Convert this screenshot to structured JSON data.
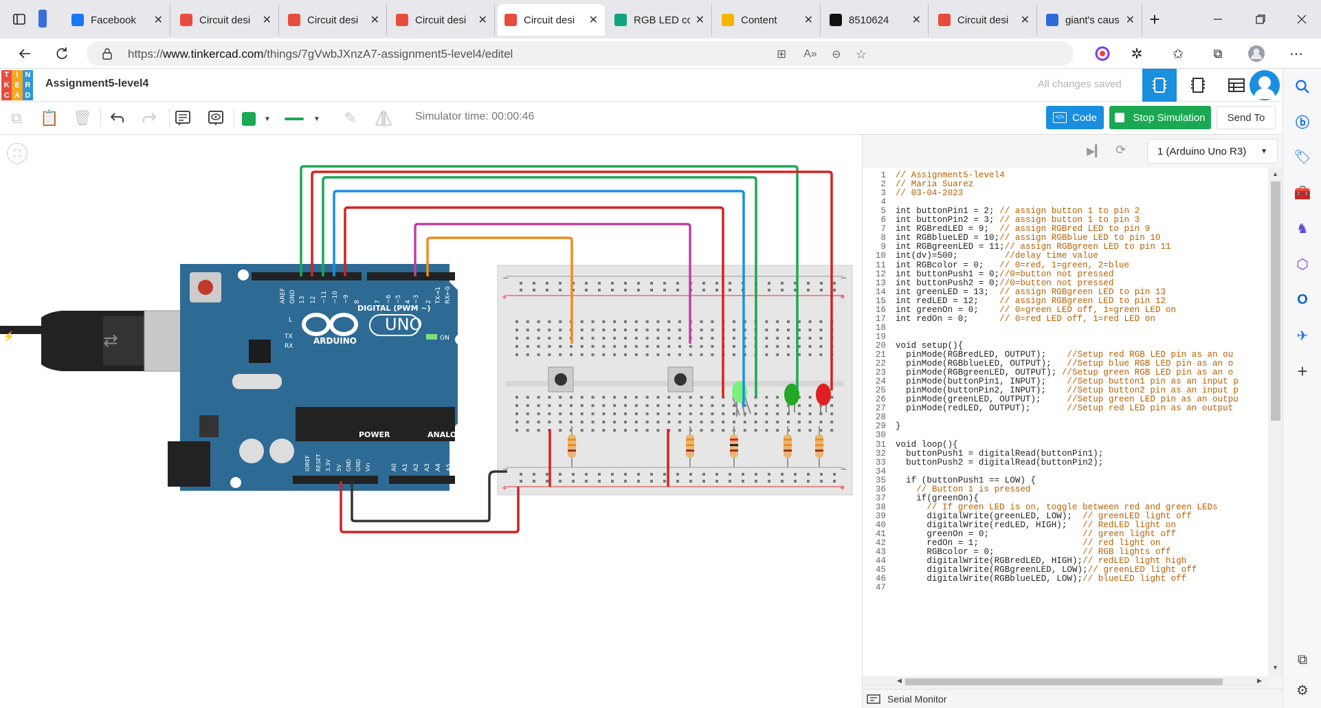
{
  "browser": {
    "tabs": [
      {
        "title": "Facebook",
        "icon": "facebook-icon",
        "color": "#1877f2",
        "active": false
      },
      {
        "title": "Circuit desi",
        "icon": "tinkercad-icon",
        "color": "#e84c3d",
        "active": false
      },
      {
        "title": "Circuit desi",
        "icon": "tinkercad-icon",
        "color": "#e84c3d",
        "active": false
      },
      {
        "title": "Circuit desi",
        "icon": "tinkercad-icon",
        "color": "#e84c3d",
        "active": false
      },
      {
        "title": "Circuit desi",
        "icon": "tinkercad-icon",
        "color": "#e84c3d",
        "active": true
      },
      {
        "title": "RGB LED co",
        "icon": "chatgpt-icon",
        "color": "#10a37f",
        "active": false
      },
      {
        "title": "Content",
        "icon": "pencil-icon",
        "color": "#f5b400",
        "active": false
      },
      {
        "title": "8510624",
        "icon": "blackboard-icon",
        "color": "#111111",
        "active": false
      },
      {
        "title": "Circuit desi",
        "icon": "tinkercad-icon",
        "color": "#e84c3d",
        "active": false
      },
      {
        "title": "giant's caus",
        "icon": "search-icon",
        "color": "#2f6bd8",
        "active": false
      }
    ],
    "url_prefix": "https://",
    "url_domain": "www.tinkercad.com",
    "url_path": "/things/7gVwbJXnzA7-assignment5-level4/editel"
  },
  "tinkercad": {
    "logo_letters": [
      "T",
      "I",
      "N",
      "K",
      "E",
      "R",
      "C",
      "A",
      "D"
    ],
    "logo_colors": [
      "#e84c3d",
      "#f5a623",
      "#2f97d8",
      "#e84c3d",
      "#f5a623",
      "#2f97d8",
      "#e84c3d",
      "#f5a623",
      "#2f97d8"
    ],
    "project_title": "Assignment5-level4",
    "save_status": "All changes saved",
    "sim_time": "Simulator time: 00:00:46",
    "code_button": "Code",
    "stop_button": "Stop Simulation",
    "send_button": "Send To",
    "device_select": "1 (Arduino Uno R3)",
    "serial_monitor": "Serial Monitor",
    "accent": "#1a8fe0",
    "stop_color": "#1aa952"
  },
  "board": {
    "uno": "UNO",
    "arduino": "ARDUINO",
    "digital_label": "DIGITAL (PWM ~)",
    "power_label": "POWER",
    "analog_label": "ANALOG IN",
    "on_label": "ON",
    "pin_labels": [
      "AREF",
      "GND",
      "13",
      "12",
      "~11",
      "~10",
      "~9",
      "8",
      "7",
      "~6",
      "~5",
      "4",
      "~3",
      "2",
      "TX→1",
      "RX←0"
    ],
    "power_pins": [
      "IOREF",
      "RESET",
      "3.3V",
      "5V",
      "GND",
      "GND",
      "Vin"
    ],
    "analog_pins": [
      "A0",
      "A1",
      "A2",
      "A3",
      "A4",
      "A5"
    ],
    "l_label": "L",
    "tx_label": "TX",
    "rx_label": "RX"
  },
  "code": {
    "lines": [
      {
        "n": "1",
        "t": "// Assignment5-level4",
        "c": ""
      },
      {
        "n": "2",
        "t": "// Maria Suarez",
        "c": ""
      },
      {
        "n": "3",
        "t": "// 03-04-2023",
        "c": ""
      },
      {
        "n": "4",
        "t": "",
        "c": ""
      },
      {
        "n": "5",
        "t": "int buttonPin1 = 2; ",
        "c": "// assign button 1 to pin 2"
      },
      {
        "n": "6",
        "t": "int buttonPin2 = 3; ",
        "c": "// assign button 1 to pin 3"
      },
      {
        "n": "7",
        "t": "int RGBredLED = 9;  ",
        "c": "// assign RGBred LED to pin 9"
      },
      {
        "n": "8",
        "t": "int RGBblueLED = 10;",
        "c": "// assign RGBblue LED to pin 10"
      },
      {
        "n": "9",
        "t": "int RGBgreenLED = 11;",
        "c": "// assign RGBgreen LED to pin 11"
      },
      {
        "n": "10",
        "t": "int(dv)=500;         ",
        "c": "//delay time value"
      },
      {
        "n": "11",
        "t": "int RGBcolor = 0;   ",
        "c": "// 0=red, 1=green, 2=blue"
      },
      {
        "n": "12",
        "t": "int buttonPush1 = 0;",
        "c": "//0=button not pressed"
      },
      {
        "n": "13",
        "t": "int buttonPush2 = 0;",
        "c": "//0=button not pressed"
      },
      {
        "n": "14",
        "t": "int greenLED = 13;  ",
        "c": "// assign RGBgreen LED to pin 13"
      },
      {
        "n": "15",
        "t": "int redLED = 12;    ",
        "c": "// assign RGBgreen LED to pin 12"
      },
      {
        "n": "16",
        "t": "int greenOn = 0;    ",
        "c": "// 0=green LED off, 1=green LED on"
      },
      {
        "n": "17",
        "t": "int redOn = 0;      ",
        "c": "// 0=red LED off, 1=red LED on"
      },
      {
        "n": "18",
        "t": "",
        "c": ""
      },
      {
        "n": "19",
        "t": "",
        "c": ""
      },
      {
        "n": "20",
        "t": "void setup(){",
        "c": ""
      },
      {
        "n": "21",
        "t": "  pinMode(RGBredLED, OUTPUT);    ",
        "c": "//Setup red RGB LED pin as an ou"
      },
      {
        "n": "22",
        "t": "  pinMode(RGBblueLED, OUTPUT);   ",
        "c": "//Setup blue RGB LED pin as an o"
      },
      {
        "n": "23",
        "t": "  pinMode(RGBgreenLED, OUTPUT); ",
        "c": "//Setup green RGB LED pin as an o"
      },
      {
        "n": "24",
        "t": "  pinMode(buttonPin1, INPUT);    ",
        "c": "//Setup button1 pin as an input p"
      },
      {
        "n": "25",
        "t": "  pinMode(buttonPin2, INPUT);    ",
        "c": "//Setup button2 pin as an input p"
      },
      {
        "n": "26",
        "t": "  pinMode(greenLED, OUTPUT);     ",
        "c": "//Setup green LED pin as an outpu"
      },
      {
        "n": "27",
        "t": "  pinMode(redLED, OUTPUT);       ",
        "c": "//Setup red LED pin as an output"
      },
      {
        "n": "28",
        "t": "",
        "c": ""
      },
      {
        "n": "29",
        "t": "}",
        "c": ""
      },
      {
        "n": "30",
        "t": "",
        "c": ""
      },
      {
        "n": "31",
        "t": "void loop(){",
        "c": ""
      },
      {
        "n": "32",
        "t": "  buttonPush1 = digitalRead(buttonPin1);",
        "c": ""
      },
      {
        "n": "33",
        "t": "  buttonPush2 = digitalRead(buttonPin2);",
        "c": ""
      },
      {
        "n": "34",
        "t": "",
        "c": ""
      },
      {
        "n": "35",
        "t": "  if (buttonPush1 == LOW) {",
        "c": ""
      },
      {
        "n": "36",
        "t": "    ",
        "c": "// Button 1 is pressed"
      },
      {
        "n": "37",
        "t": "    if(greenOn){",
        "c": ""
      },
      {
        "n": "38",
        "t": "      ",
        "c": "// If green LED is on, toggle between red and green LEDs"
      },
      {
        "n": "39",
        "t": "      digitalWrite(greenLED, LOW);  ",
        "c": "// greenLED light off"
      },
      {
        "n": "40",
        "t": "      digitalWrite(redLED, HIGH);   ",
        "c": "// RedLED light on"
      },
      {
        "n": "41",
        "t": "      greenOn = 0;                  ",
        "c": "// green light off"
      },
      {
        "n": "42",
        "t": "      redOn = 1;                    ",
        "c": "// red light on"
      },
      {
        "n": "43",
        "t": "      RGBcolor = 0;                 ",
        "c": "// RGB lights off"
      },
      {
        "n": "44",
        "t": "      digitalWrite(RGBredLED, HIGH);",
        "c": "// redLED light high"
      },
      {
        "n": "45",
        "t": "      digitalWrite(RGBgreenLED, LOW);",
        "c": "// greenLED light off"
      },
      {
        "n": "46",
        "t": "      digitalWrite(RGBblueLED, LOW);",
        "c": "// blueLED light off"
      },
      {
        "n": "47",
        "t": "",
        "c": ""
      }
    ]
  }
}
